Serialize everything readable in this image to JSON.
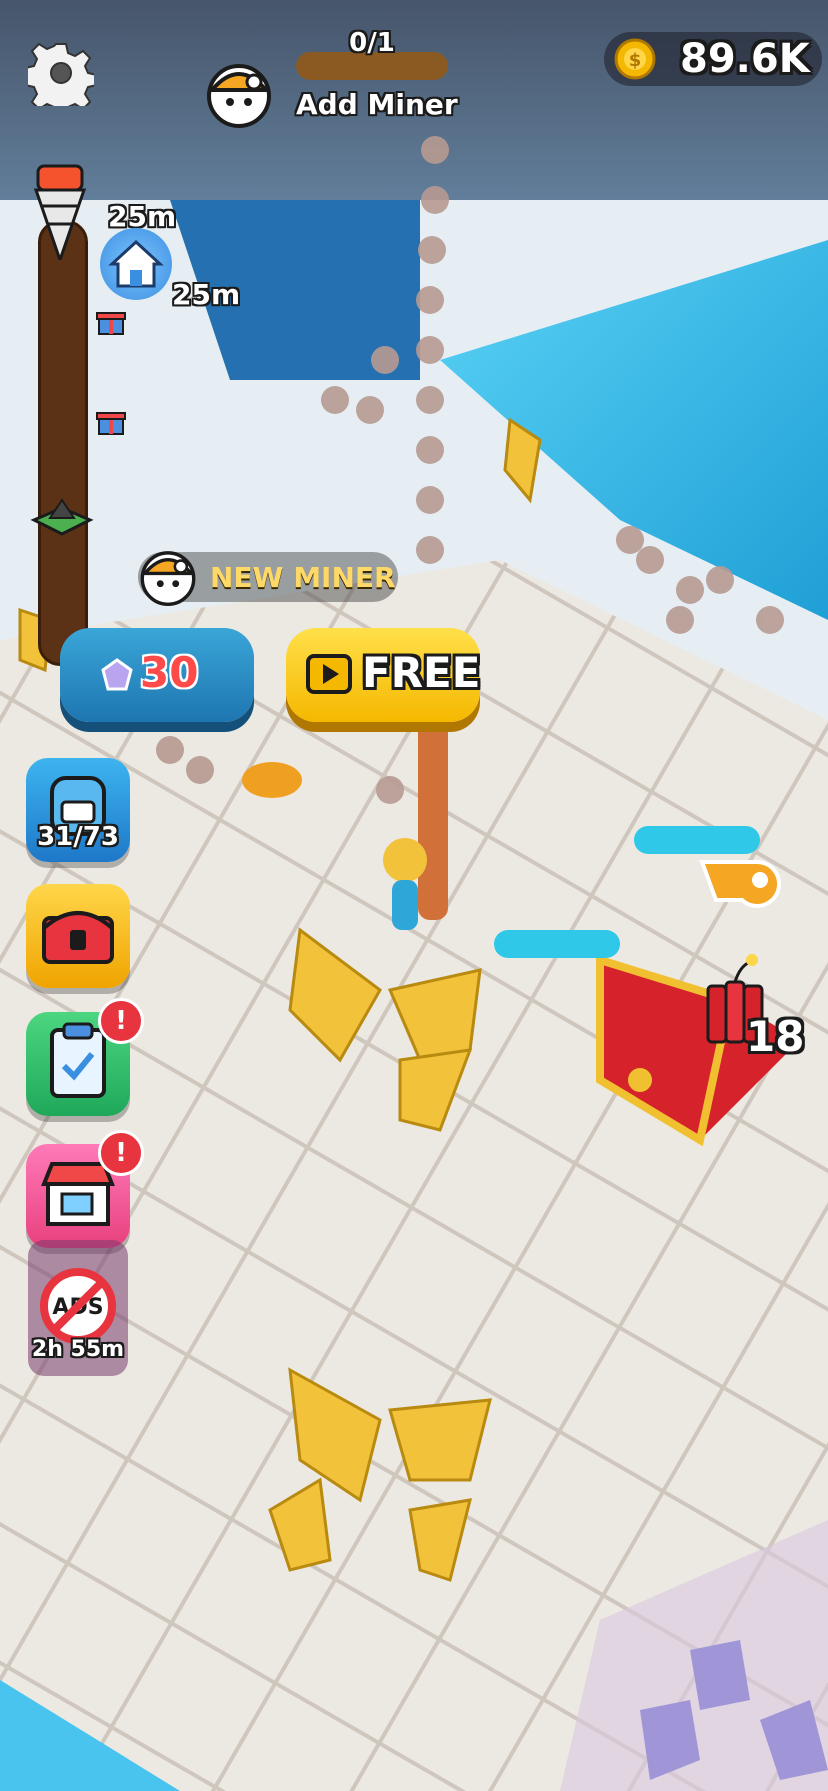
{
  "hud": {
    "add_miner": {
      "progress": "0/1",
      "progress_fraction": 0,
      "label": "Add Miner"
    },
    "coins": "89.6K"
  },
  "depth": {
    "current": "25m",
    "home": "25m"
  },
  "hire": {
    "new_miner_label": "NEW MINER",
    "gem_cost": "30",
    "free_label": "FREE"
  },
  "side_menu": {
    "backpack_count": "31/73",
    "no_ads_timer": "2h 55m",
    "no_ads_icon_text": "ADS"
  },
  "dynamite_count": "18",
  "colors": {
    "ice": "#2fb9e6",
    "sky": "#7fd6f2",
    "coin": "#f5b800",
    "gem_button": "#1e76b0",
    "free_button": "#f5b800",
    "alert": "#e8343e"
  }
}
